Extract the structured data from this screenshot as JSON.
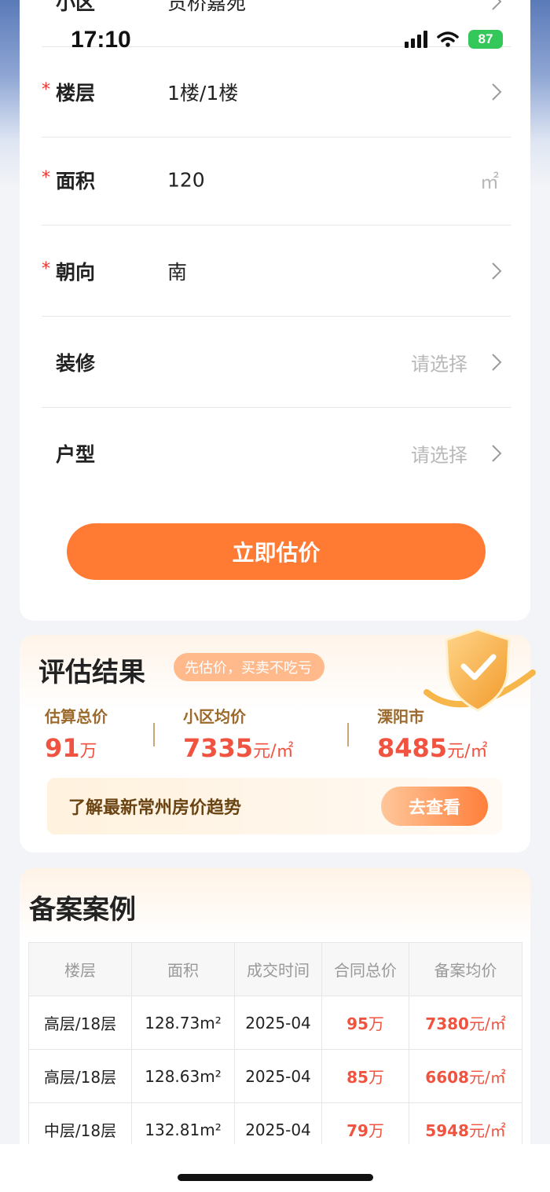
{
  "status_bar": {
    "time": "17:10",
    "battery": "87"
  },
  "form": {
    "community": {
      "label": "小区",
      "value": "贡桥嘉苑",
      "required": true
    },
    "floor": {
      "label": "楼层",
      "value": "1楼/1楼",
      "required": true
    },
    "area": {
      "label": "面积",
      "value": "120",
      "unit": "㎡",
      "required": true
    },
    "orientation": {
      "label": "朝向",
      "value": "南",
      "required": true
    },
    "decoration": {
      "label": "装修",
      "placeholder": "请选择",
      "required": false
    },
    "layout": {
      "label": "户型",
      "placeholder": "请选择",
      "required": false
    },
    "required_mark": "*",
    "submit_label": "立即估价"
  },
  "result": {
    "title": "评估结果",
    "tag": "先估价，买卖不吃亏",
    "stats": [
      {
        "label": "估算总价",
        "value": "91",
        "unit": "万"
      },
      {
        "label": "小区均价",
        "value": "7335",
        "unit": "元/㎡"
      },
      {
        "label": "溧阳市",
        "value": "8485",
        "unit": "元/㎡"
      }
    ],
    "trend_text": "了解最新常州房价趋势",
    "trend_button": "去查看"
  },
  "cases": {
    "title": "备案案例",
    "headers": [
      "楼层",
      "面积",
      "成交时间",
      "合同总价",
      "备案均价"
    ],
    "rows": [
      {
        "floor": "高层/18层",
        "area": "128.73m²",
        "date": "2025-04",
        "total": "95",
        "total_unit": "万",
        "avg": "7380",
        "avg_unit": "元/㎡"
      },
      {
        "floor": "高层/18层",
        "area": "128.63m²",
        "date": "2025-04",
        "total": "85",
        "total_unit": "万",
        "avg": "6608",
        "avg_unit": "元/㎡"
      },
      {
        "floor": "中层/18层",
        "area": "132.81m²",
        "date": "2025-04",
        "total": "79",
        "total_unit": "万",
        "avg": "5948",
        "avg_unit": "元/㎡"
      }
    ]
  }
}
